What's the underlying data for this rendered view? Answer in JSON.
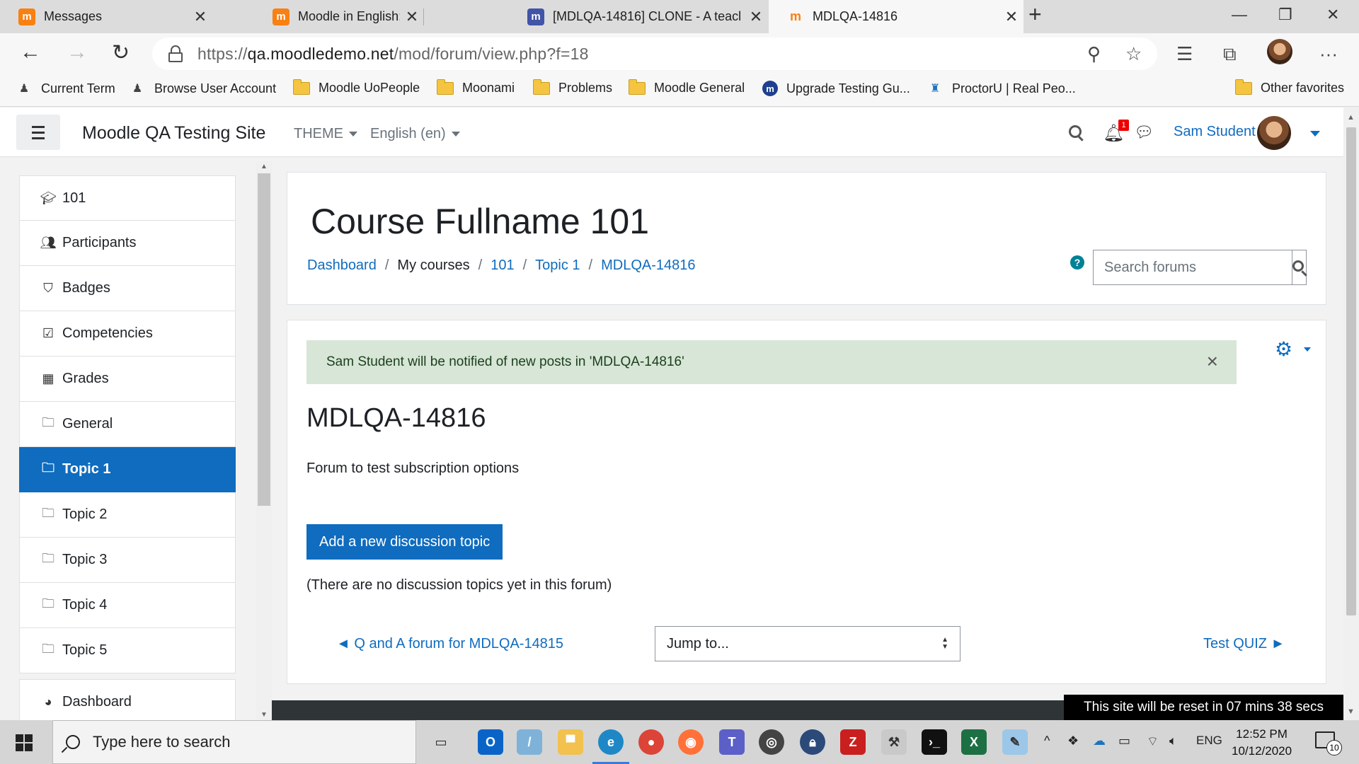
{
  "browser": {
    "tabs": [
      {
        "label": "Messages",
        "favicon": "moodle-icon"
      },
      {
        "label": "Moodle in English: Forwarding w",
        "favicon": "moodle-icon"
      },
      {
        "label": "[MDLQA-14816] CLONE - A teacl",
        "favicon": "moodle-app-icon"
      },
      {
        "label": "MDLQA-14816",
        "favicon": "moodle-icon"
      }
    ],
    "url_prefix": "https://",
    "url_host": "qa.moodledemo.net",
    "url_path": "/mod/forum/view.php?f=18",
    "bookmarks": [
      {
        "label": "Current Term",
        "icon": "person-icon"
      },
      {
        "label": "Browse User Account",
        "icon": "person-icon"
      },
      {
        "label": "Moodle UoPeople",
        "icon": "folder-icon"
      },
      {
        "label": "Moonami",
        "icon": "folder-icon"
      },
      {
        "label": "Problems",
        "icon": "folder-icon"
      },
      {
        "label": "Moodle General",
        "icon": "folder-icon"
      },
      {
        "label": "Upgrade Testing Gu...",
        "icon": "moodle-app-icon"
      },
      {
        "label": "ProctorU | Real Peo...",
        "icon": "owl-icon"
      }
    ],
    "other_favorites": "Other favorites"
  },
  "navbar": {
    "site_name": "Moodle QA Testing Site",
    "theme_label": "THEME",
    "language_label": "English (en)",
    "notification_count": "1",
    "user_name": "Sam Student"
  },
  "drawer": {
    "items": [
      {
        "label": "101",
        "icon": "graduation-cap-icon"
      },
      {
        "label": "Participants",
        "icon": "users-icon"
      },
      {
        "label": "Badges",
        "icon": "shield-icon"
      },
      {
        "label": "Competencies",
        "icon": "checkbox-icon"
      },
      {
        "label": "Grades",
        "icon": "table-icon"
      },
      {
        "label": "General",
        "icon": "folder-icon"
      },
      {
        "label": "Topic 1",
        "icon": "folder-icon",
        "active": true
      },
      {
        "label": "Topic 2",
        "icon": "folder-icon"
      },
      {
        "label": "Topic 3",
        "icon": "folder-icon"
      },
      {
        "label": "Topic 4",
        "icon": "folder-icon"
      },
      {
        "label": "Topic 5",
        "icon": "folder-icon"
      }
    ],
    "dashboard": {
      "label": "Dashboard",
      "icon": "dashboard-icon"
    }
  },
  "header": {
    "course_title": "Course Fullname 101",
    "breadcrumbs": [
      "Dashboard",
      "My courses",
      "101",
      "Topic 1",
      "MDLQA-14816"
    ],
    "search_placeholder": "Search forums"
  },
  "main": {
    "alert_text": "Sam Student will be notified of new posts in 'MDLQA-14816'",
    "forum_title": "MDLQA-14816",
    "forum_description": "Forum to test subscription options",
    "add_button_label": "Add a new discussion topic",
    "no_topics_text": "(There are no discussion topics yet in this forum)",
    "prev_link": "◄ Q and A forum for MDLQA-14815",
    "jump_to_label": "Jump to...",
    "next_link": "Test QUIZ ►"
  },
  "reset_notice": "This site will be reset in 07 mins 38 secs",
  "taskbar": {
    "search_placeholder": "Type here to search",
    "language": "ENG",
    "time": "12:52 PM",
    "date": "10/12/2020",
    "notifications": "10"
  },
  "colors": {
    "brand_blue": "#0f6cbf",
    "alert_green": "#d7e6d7",
    "moodle_orange": "#f98012"
  }
}
